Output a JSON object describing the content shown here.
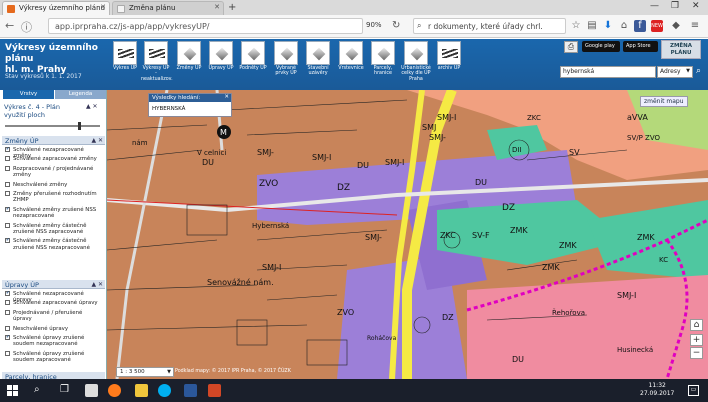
{
  "browser": {
    "tabs": [
      {
        "label": "Výkresy územního plánu"
      },
      {
        "label": "Změna plánu"
      }
    ],
    "url": "app.iprpraha.cz/js-app/app/vykresyUP/",
    "zoom": "90%",
    "search_value": "r dokumenty, které úřady chrl.",
    "new_badge": "NEW"
  },
  "app": {
    "title_line1": "Výkresy územního plánu",
    "title_line2": "hl. m. Prahy",
    "state": "Stav výkresů k 1. 1. 2017",
    "tools": [
      {
        "label": "Výkres ÚP"
      },
      {
        "label": "Výkresy ÚP - neaktualizov."
      },
      {
        "label": "Změny ÚP"
      },
      {
        "label": "Úpravy ÚP"
      },
      {
        "label": "Podněty ÚP"
      },
      {
        "label": "Vybrané prvky ÚP"
      },
      {
        "label": "Stavební uzávěry"
      },
      {
        "label": "Vrstevnice"
      },
      {
        "label": "Parcely, hranice"
      },
      {
        "label": "Urbanistické celky dle ÚP Praha"
      },
      {
        "label": "archiv ÚP"
      }
    ],
    "store_badges": [
      "Google play",
      "App Store"
    ],
    "change_button": "ZMĚNA PLÁNU",
    "place_input": "hybernská",
    "place_type": "Adresy"
  },
  "panel": {
    "tabs": [
      "Vrstvy",
      "Legenda"
    ],
    "layer_title": "Výkres č. 4 - Plán využití ploch",
    "sections": [
      {
        "title": "Změny ÚP",
        "items": [
          {
            "label": "Schválené nezapracované změny",
            "checked": true
          },
          {
            "label": "Schválené zapracované změny",
            "checked": false
          },
          {
            "label": "Rozpracované / projednávané změny",
            "checked": false
          },
          {
            "label": "Neschválené změny",
            "checked": false
          },
          {
            "label": "Změny přerušené rozhodnutím ZHMP",
            "checked": false
          },
          {
            "label": "Schválené změny zrušené NSS nezapracované",
            "checked": true
          },
          {
            "label": "Schválené změny částečně zrušené NSS zapracované",
            "checked": false
          },
          {
            "label": "Schválené změny částečně zrušené NSS nezapracované",
            "checked": true
          }
        ]
      },
      {
        "title": "Úpravy ÚP",
        "items": [
          {
            "label": "Schválené nezapracované úpravy",
            "checked": true
          },
          {
            "label": "Schválené zapracované úpravy",
            "checked": false
          },
          {
            "label": "Projednávané / přerušené úpravy",
            "checked": false
          },
          {
            "label": "Neschválené úpravy",
            "checked": false
          },
          {
            "label": "Schválené úpravy zrušené soudem nezapracované",
            "checked": true
          },
          {
            "label": "Schválené úpravy zrušené soudem zapracované",
            "checked": false
          }
        ]
      },
      {
        "title": "Parcely, hranice",
        "items": []
      }
    ]
  },
  "map": {
    "result_title": "Výsledky hledání:",
    "result_value": "HYBERNSKÁ",
    "change_map": "změnit mapu",
    "scale": "1 : 3 500",
    "credits": "Podklad mapy: © 2017 IPR Praha, © 2017 ČÚZK",
    "labels": {
      "zvo1": "ZVO",
      "dz1": "DZ",
      "smj1": "SMJ-",
      "smj2": "SMJ-I",
      "du1": "DU",
      "du2": "DU",
      "smj3": "SMJ-I",
      "smj4": "SMJ-",
      "smj5": "SMJ-",
      "dz2": "DZ",
      "smj6": "SMJ-I",
      "zkc1": "ZKC",
      "svf": "SV-F",
      "zmk1": "ZMK",
      "zmk2": "ZMK",
      "zmk3": "ZMK",
      "zmk4": "ZMK",
      "sv": "SV",
      "dii": "DII",
      "avva": "aVVA",
      "kc": "KC",
      "kc2": "ZKC",
      "smj7": "SMJ-I",
      "svpzvo": "SV/P ZVO",
      "du3": "DU",
      "du4": "DU",
      "dz3": "DZ",
      "zvo2": "ZVO",
      "smj8": "SMJ",
      "smj9": "SMJ-I",
      "senovazne": "Senovážné nám.",
      "vcelnici": "V celnici",
      "hybernska": "Hybernská",
      "rehorova": "Řehořova",
      "husinecka": "Husinecká",
      "ul1": "Roháčova",
      "nam": "nám"
    }
  },
  "taskbar": {
    "time": "11:32",
    "date": "27.09.2017"
  },
  "colors": {
    "header_blue": "#1a67ad",
    "map_brown": "#c8845a",
    "map_purple": "#9c7fd8",
    "map_teal": "#4fc7a0",
    "map_yellow": "#f5ea44",
    "map_pink": "#f08ca0"
  }
}
